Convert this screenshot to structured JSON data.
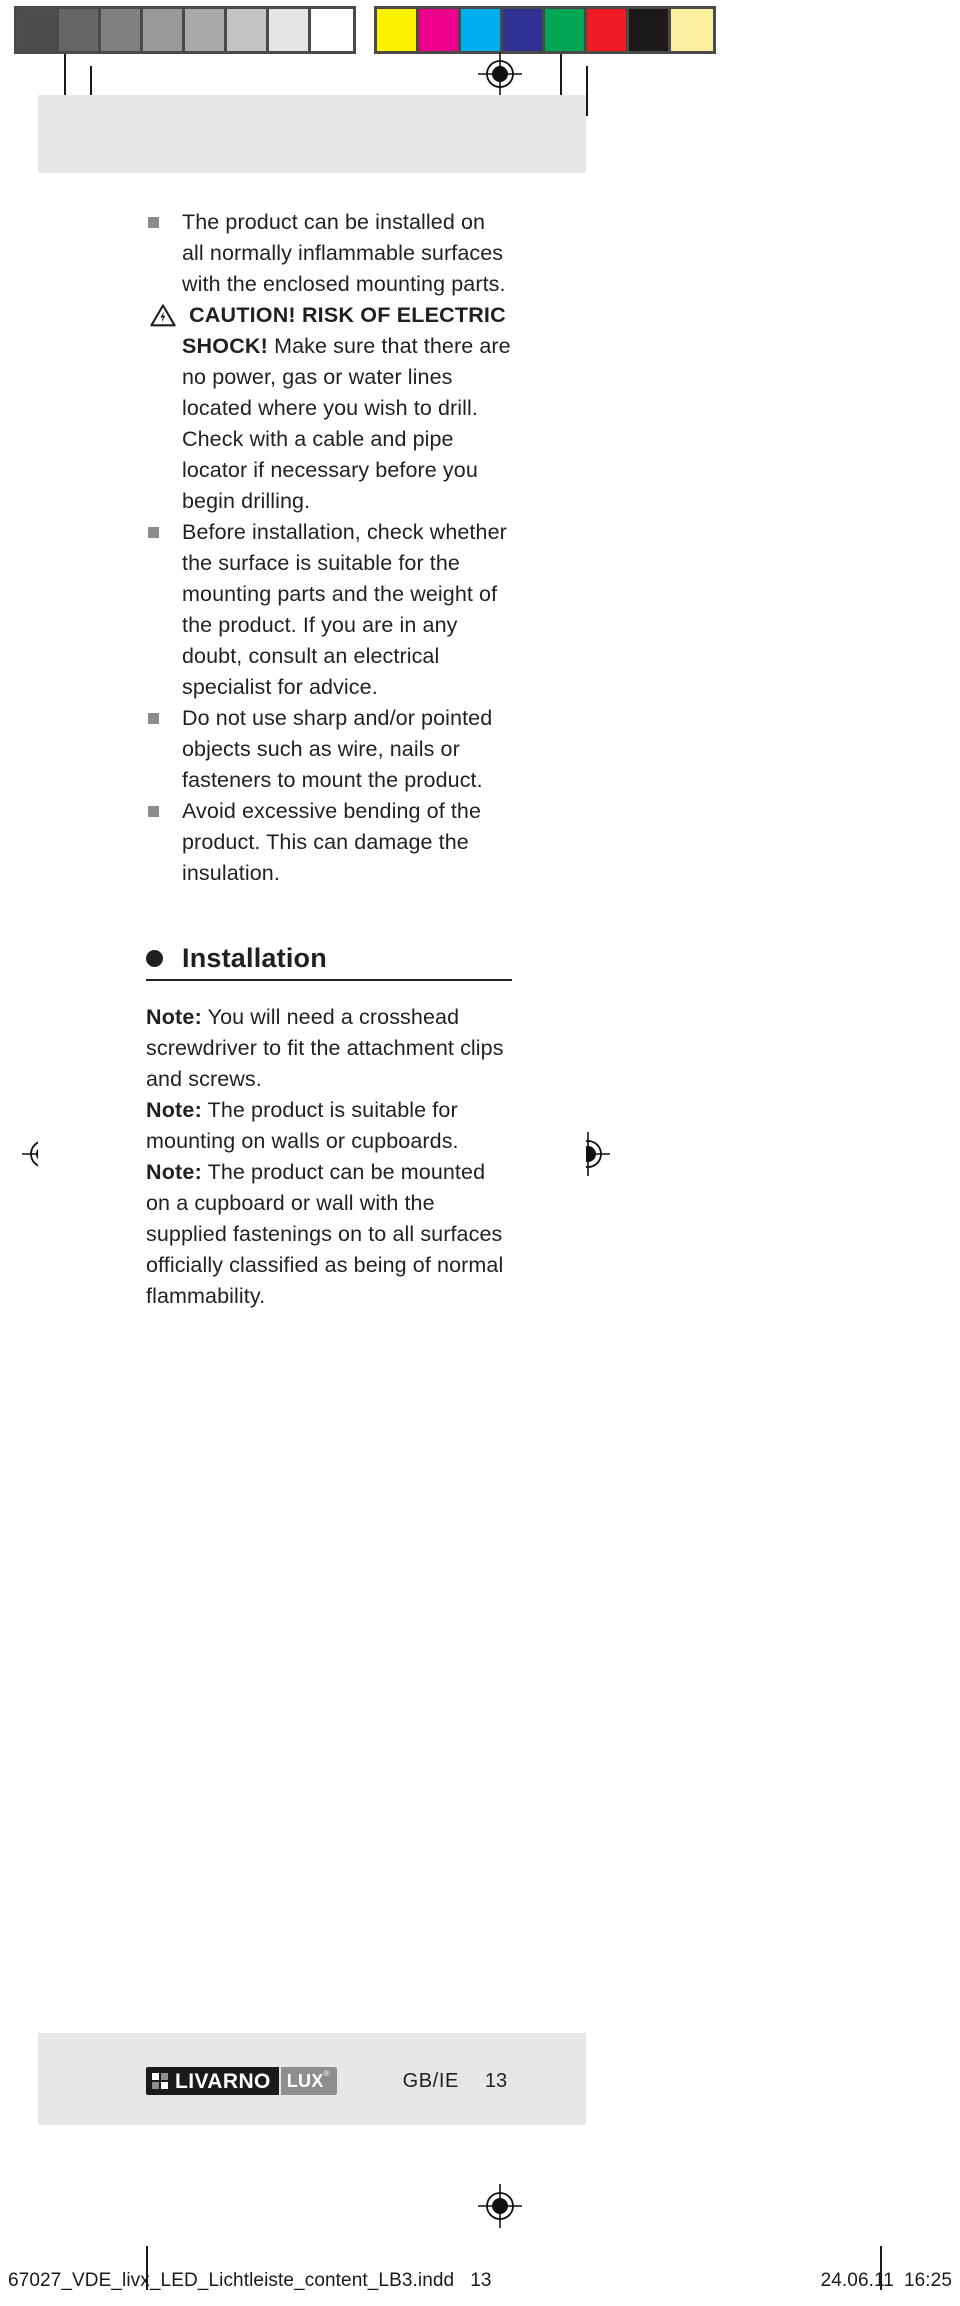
{
  "colorbar": {
    "gray_patches": [
      "#4d4d4d",
      "#666666",
      "#808080",
      "#999999",
      "#a8a8a8",
      "#c4c4c4",
      "#e4e4e4",
      "#ffffff"
    ],
    "color_patches": [
      "#fff200",
      "#ec008c",
      "#00aeef",
      "#2e3192",
      "#00a651",
      "#ed1c24",
      "#1a1a1a",
      "#fbefa0"
    ]
  },
  "bullets": [
    {
      "text": "The product can be installed on all normally inflammable surfaces with the enclosed mounting parts.",
      "icon": "square-bullet"
    },
    {
      "icon": "warning-triangle-icon",
      "bold": "CAUTION! RISK OF ELECTRIC SHOCK!",
      "text": " Make sure that there are no power, gas or water lines located where you wish to drill. Check with a cable and pipe locator if necessary before you begin drilling."
    },
    {
      "text": "Before installation, check whether the surface is suitable for the mounting parts and the weight of the product. If you are in any doubt, consult an electrical specialist for advice.",
      "icon": "square-bullet"
    },
    {
      "text": "Do not use sharp and/or pointed objects such as wire, nails or fasteners to mount the product.",
      "icon": "square-bullet"
    },
    {
      "text": "Avoid excessive bending of the product. This can damage the insulation.",
      "icon": "square-bullet"
    }
  ],
  "section": {
    "heading": "Installation",
    "bullet_icon": "circle-bullet",
    "notes": [
      {
        "label": "Note:",
        "text": " You will need a crosshead screwdriver to fit the attachment clips and screws."
      },
      {
        "label": "Note:",
        "text": " The product is suitable for mounting on walls or cupboards."
      },
      {
        "label": "Note:",
        "text": " The product can be mounted on a cupboard or wall with the supplied fastenings on to all surfaces officially classified as being of normal flammability."
      }
    ]
  },
  "footer": {
    "logo_main": "LIVARNO",
    "logo_lux": "LUX",
    "logo_reg": "®",
    "page_mark": "GB/IE",
    "page_number": "13"
  },
  "imprint": {
    "filename": "67027_VDE_livx_LED_Lichtleiste_content_LB3.indd",
    "page": "13",
    "date": "24.06.11",
    "time": "16:25"
  }
}
